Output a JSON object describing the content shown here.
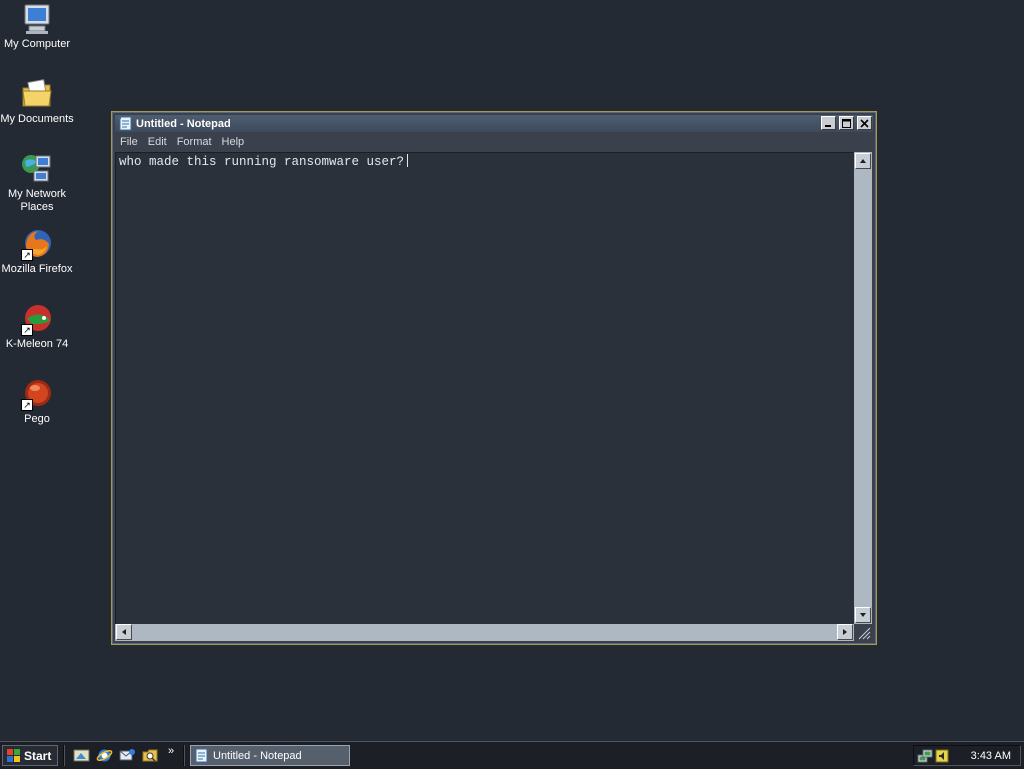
{
  "desktop": {
    "icons": [
      {
        "label": "My Computer",
        "icon": "computer-icon"
      },
      {
        "label": "My Documents",
        "icon": "documents-folder-icon"
      },
      {
        "label": "My Network Places",
        "icon": "network-places-icon"
      },
      {
        "label": "Mozilla Firefox",
        "icon": "firefox-icon"
      },
      {
        "label": "K-Meleon 74",
        "icon": "k-meleon-icon"
      },
      {
        "label": "Pego",
        "icon": "pego-icon"
      }
    ]
  },
  "window": {
    "title": "Untitled - Notepad",
    "icon": "notepad-icon",
    "menu": [
      "File",
      "Edit",
      "Format",
      "Help"
    ],
    "content": "who made this running ransomware user?"
  },
  "taskbar": {
    "start_label": "Start",
    "quick_launch": [
      "show-desktop-icon",
      "internet-explorer-icon",
      "outlook-express-icon",
      "folder-search-icon"
    ],
    "overflow_label": "»",
    "task_label": "Untitled - Notepad",
    "tray_icons": [
      "network-connection-icon",
      "volume-tray-icon"
    ],
    "clock": "3:43 AM"
  },
  "colors": {
    "desktop": "#242a33",
    "window_frame_accent": "#a59a55",
    "titlebar": "#4f5d70",
    "edit_background": "#2b313a"
  }
}
